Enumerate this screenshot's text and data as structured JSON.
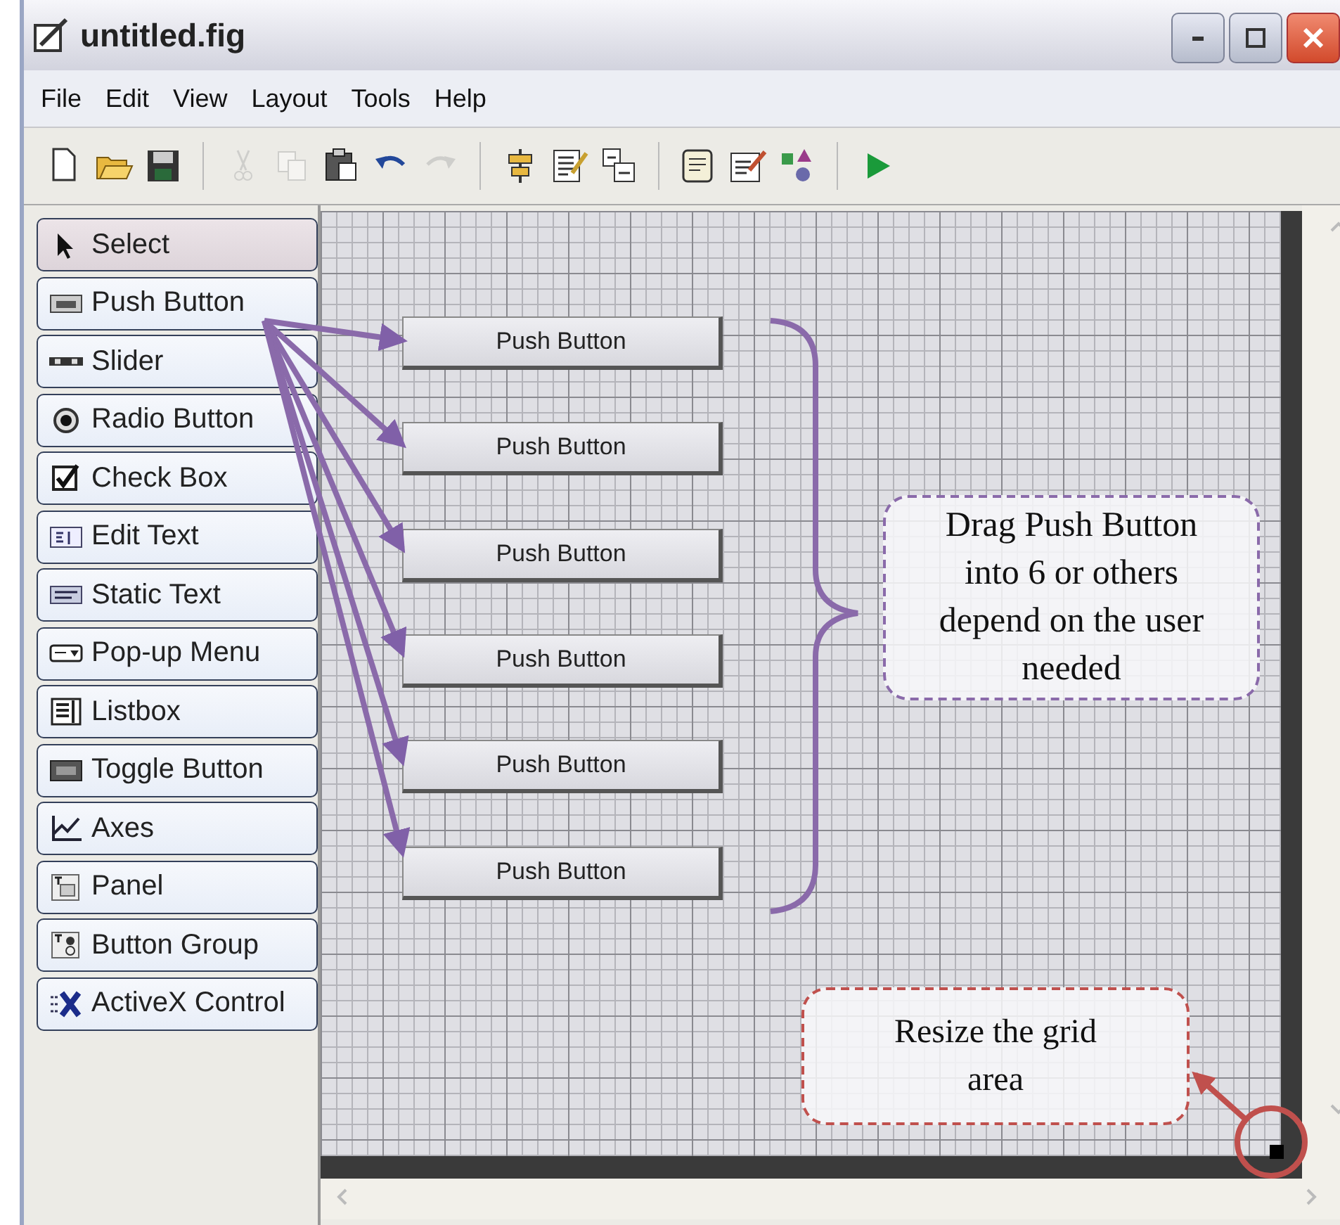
{
  "window": {
    "title": "untitled.fig"
  },
  "menu": [
    "File",
    "Edit",
    "View",
    "Layout",
    "Tools",
    "Help"
  ],
  "toolbar": [
    {
      "kind": "new",
      "disabled": false
    },
    {
      "kind": "open",
      "disabled": false
    },
    {
      "kind": "save",
      "disabled": false
    },
    {
      "kind": "sep"
    },
    {
      "kind": "cut",
      "disabled": true
    },
    {
      "kind": "copy",
      "disabled": true
    },
    {
      "kind": "paste",
      "disabled": false
    },
    {
      "kind": "undo",
      "disabled": false
    },
    {
      "kind": "redo",
      "disabled": true
    },
    {
      "kind": "sep"
    },
    {
      "kind": "align",
      "disabled": false
    },
    {
      "kind": "menu_editor",
      "disabled": false
    },
    {
      "kind": "tab_order",
      "disabled": false
    },
    {
      "kind": "sep"
    },
    {
      "kind": "editor",
      "disabled": false
    },
    {
      "kind": "inspector",
      "disabled": false
    },
    {
      "kind": "browser",
      "disabled": false
    },
    {
      "kind": "sep"
    },
    {
      "kind": "run",
      "disabled": false
    }
  ],
  "palette": [
    {
      "label": "Select",
      "kind": "select",
      "selected": true
    },
    {
      "label": "Push Button",
      "kind": "push",
      "selected": false
    },
    {
      "label": "Slider",
      "kind": "slider",
      "selected": false
    },
    {
      "label": "Radio Button",
      "kind": "radio",
      "selected": false
    },
    {
      "label": "Check Box",
      "kind": "check",
      "selected": false
    },
    {
      "label": "Edit Text",
      "kind": "edit",
      "selected": false
    },
    {
      "label": "Static Text",
      "kind": "static",
      "selected": false
    },
    {
      "label": "Pop-up Menu",
      "kind": "popup",
      "selected": false
    },
    {
      "label": "Listbox",
      "kind": "listbox",
      "selected": false
    },
    {
      "label": "Toggle Button",
      "kind": "toggle",
      "selected": false
    },
    {
      "label": "Axes",
      "kind": "axes",
      "selected": false
    },
    {
      "label": "Panel",
      "kind": "panel",
      "selected": false
    },
    {
      "label": "Button Group",
      "kind": "group",
      "selected": false
    },
    {
      "label": "ActiveX Control",
      "kind": "activex",
      "selected": false
    }
  ],
  "canvas": {
    "buttons": [
      {
        "label": "Push Button"
      },
      {
        "label": "Push Button"
      },
      {
        "label": "Push Button"
      },
      {
        "label": "Push Button"
      },
      {
        "label": "Push Button"
      },
      {
        "label": "Push Button"
      }
    ]
  },
  "annotations": [
    {
      "kind": "drag",
      "text": "Drag Push Button into 6 or others depend on the user needed",
      "color": "#8a6aaa"
    },
    {
      "kind": "resize",
      "text": "Resize the grid area",
      "color": "#c0504d"
    }
  ]
}
